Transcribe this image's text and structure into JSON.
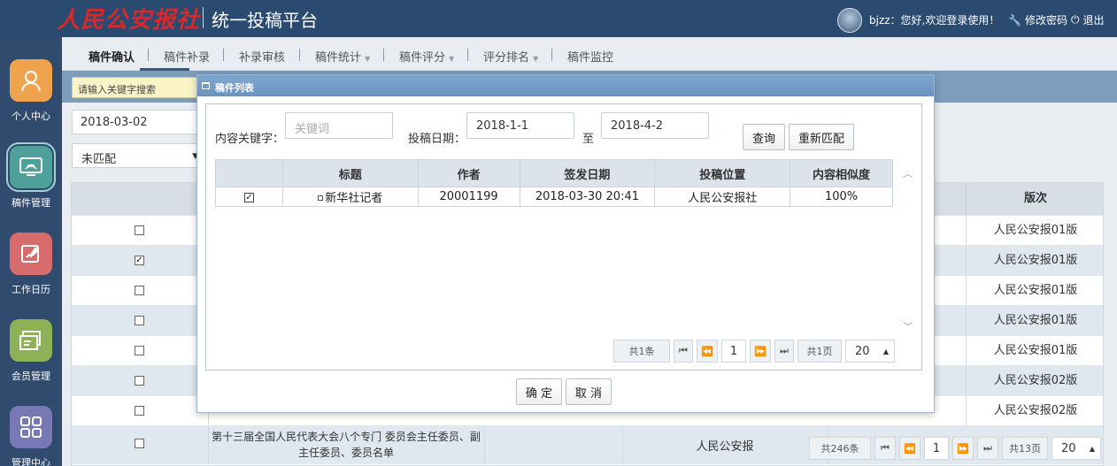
{
  "header": {
    "logo_text": "人民公安报社",
    "platform_title": "统一投稿平台",
    "greeting": "bjzz：您好,欢迎登录使用！",
    "change_password": "修改密码",
    "logout": "退出"
  },
  "sidebar": {
    "items": [
      {
        "label": "个人中心",
        "icon": "person-icon",
        "color": "#f0a34d"
      },
      {
        "label": "稿件管理",
        "icon": "monitor-icon",
        "color": "#4f9f9a"
      },
      {
        "label": "工作日历",
        "icon": "calendar-edit-icon",
        "color": "#d86b6b"
      },
      {
        "label": "会员管理",
        "icon": "member-card-icon",
        "color": "#8cb156"
      },
      {
        "label": "管理中心",
        "icon": "grid-icon",
        "color": "#7878b4"
      }
    ]
  },
  "nav": {
    "tabs": [
      {
        "label": "稿件确认",
        "active": true,
        "dropdown": false
      },
      {
        "label": "稿件补录",
        "active": false,
        "dropdown": false
      },
      {
        "label": "补录审核",
        "active": false,
        "dropdown": false
      },
      {
        "label": "稿件统计",
        "active": false,
        "dropdown": true
      },
      {
        "label": "稿件评分",
        "active": false,
        "dropdown": true
      },
      {
        "label": "评分排名",
        "active": false,
        "dropdown": true
      },
      {
        "label": "稿件监控",
        "active": false,
        "dropdown": false
      }
    ]
  },
  "background": {
    "search_placeholder": "请输入关键字搜索",
    "date_value": "2018-03-02",
    "match_select": "未匹配",
    "table": {
      "version_header": "版次",
      "rows": [
        {
          "checked": false,
          "version": "人民公安报01版"
        },
        {
          "checked": true,
          "version": "人民公安报01版"
        },
        {
          "checked": false,
          "version": "人民公安报01版"
        },
        {
          "checked": false,
          "version": "人民公安报01版"
        },
        {
          "checked": false,
          "version": "人民公安报01版"
        },
        {
          "checked": false,
          "version": "人民公安报02版"
        },
        {
          "checked": false,
          "version": "人民公安报02版"
        }
      ],
      "last_row": {
        "title": "第十三届全国人民代表大会八个专门 委员会主任委员、副主任委员、委员名单",
        "source": "人民公安报"
      }
    },
    "pager": {
      "total_records": "共246条",
      "page": "1",
      "total_pages": "共13页",
      "page_size": "20"
    }
  },
  "modal": {
    "title": "稿件列表",
    "keyword_label": "内容关键字：",
    "keyword_placeholder": "关键词",
    "date_label": "投稿日期：",
    "date_from": "2018-1-1",
    "date_sep": "至",
    "date_to": "2018-4-2",
    "query_button": "查询",
    "rematch_button": "重新匹配",
    "table": {
      "columns": [
        "",
        "标题",
        "作者",
        "签发日期",
        "投稿位置",
        "内容相似度"
      ],
      "rows": [
        {
          "checked": true,
          "title": "新华社记者",
          "author": "20001199",
          "date": "2018-03-30 20:41",
          "position": "人民公安报社",
          "similarity": "100%"
        }
      ]
    },
    "pager": {
      "total_records": "共1条",
      "page": "1",
      "total_pages": "共1页",
      "page_size": "20"
    },
    "confirm_button": "确 定",
    "cancel_button": "取 消"
  }
}
